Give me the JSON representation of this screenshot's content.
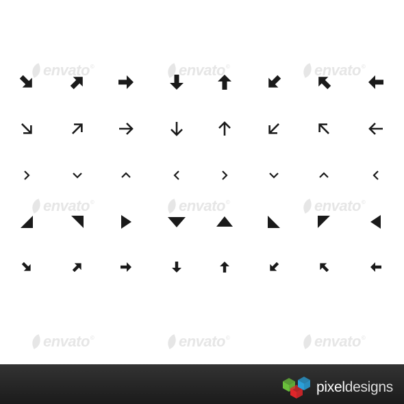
{
  "watermark": {
    "text": "envato",
    "mark": "©"
  },
  "brand": {
    "name_part1": "pixel",
    "name_part2": "designs"
  },
  "colors": {
    "icon": "#1a1a1a",
    "watermark": "#e6e6e6",
    "footer_bg": "#262626",
    "cube_green": "#6abf3b",
    "cube_red": "#e0262a",
    "cube_blue": "#2a9fd8"
  },
  "icon_rows": [
    {
      "style": "bold-arrow",
      "icons": [
        "arrow-down-right-icon",
        "arrow-up-right-icon",
        "arrow-right-icon",
        "arrow-down-icon",
        "arrow-up-icon",
        "arrow-down-left-icon",
        "arrow-up-left-icon",
        "arrow-left-icon"
      ]
    },
    {
      "style": "thin-arrow",
      "icons": [
        "arrow-down-right-icon",
        "arrow-up-right-icon",
        "arrow-right-icon",
        "arrow-down-icon",
        "arrow-up-icon",
        "arrow-down-left-icon",
        "arrow-up-left-icon",
        "arrow-left-icon"
      ]
    },
    {
      "style": "chevron",
      "icons": [
        "chevron-right-icon",
        "chevron-down-icon",
        "chevron-up-icon",
        "chevron-left-icon",
        "chevron-right-icon",
        "chevron-down-icon",
        "chevron-up-icon",
        "chevron-left-icon"
      ]
    },
    {
      "style": "triangle",
      "icons": [
        "triangle-bottom-left-icon",
        "triangle-top-left-icon",
        "triangle-right-icon",
        "triangle-down-icon",
        "triangle-up-icon",
        "triangle-bottom-right-icon",
        "triangle-top-left-icon",
        "triangle-left-icon"
      ]
    },
    {
      "style": "small-arrow",
      "icons": [
        "arrow-down-right-icon",
        "arrow-up-right-icon",
        "arrow-right-icon",
        "arrow-down-icon",
        "arrow-up-icon",
        "arrow-down-left-icon",
        "arrow-up-left-icon",
        "arrow-left-icon"
      ]
    }
  ]
}
